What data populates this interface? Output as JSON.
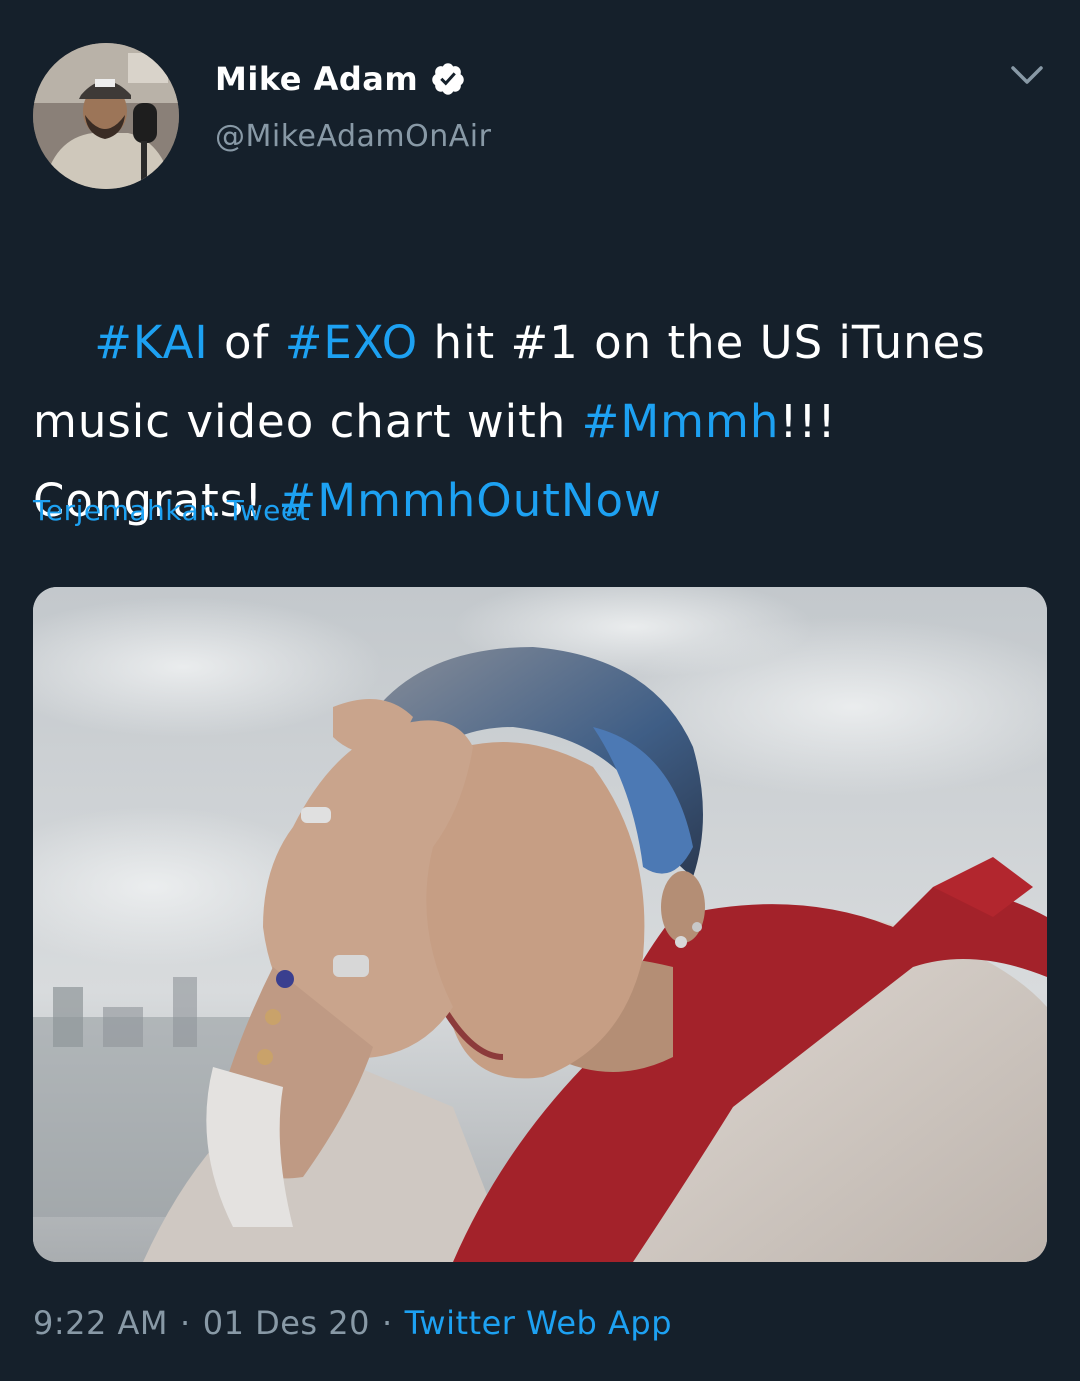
{
  "author": {
    "display_name": "Mike Adam",
    "handle": "@MikeAdamOnAir",
    "verified": true
  },
  "tweet": {
    "segments": [
      {
        "text": "#KAI",
        "hashtag": true
      },
      {
        "text": " of ",
        "hashtag": false
      },
      {
        "text": "#EXO",
        "hashtag": true
      },
      {
        "text": " hit #1 on the US iTunes music video chart with ",
        "hashtag": false
      },
      {
        "text": "#Mmmh",
        "hashtag": true
      },
      {
        "text": "!!! Congrats! ",
        "hashtag": false
      },
      {
        "text": "#MmmhOutNow",
        "hashtag": true
      }
    ]
  },
  "translate_label": "Terjemahkan Tweet",
  "meta": {
    "time": "9:22 AM",
    "separator": "·",
    "date": "01 Des 20",
    "source": "Twitter Web App"
  },
  "icons": {
    "verified": "verified-badge-icon",
    "menu": "chevron-down-icon"
  },
  "colors": {
    "background": "#15202b",
    "accent": "#1da1f2",
    "secondary_text": "#8899a6",
    "primary_text": "#ffffff"
  }
}
